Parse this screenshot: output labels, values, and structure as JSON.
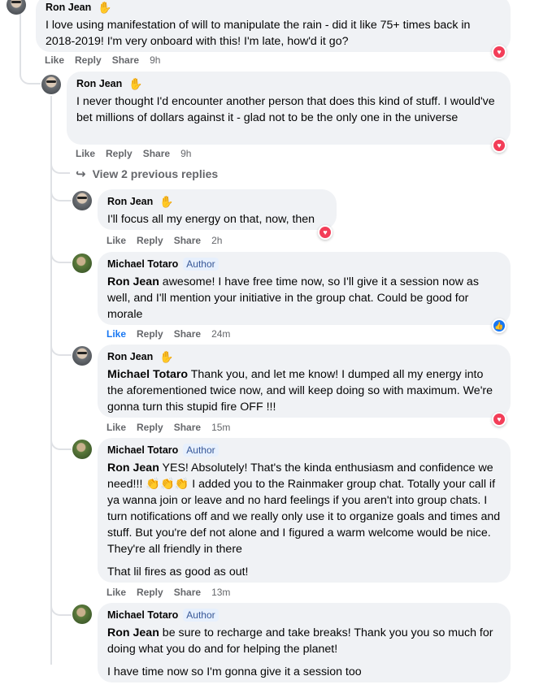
{
  "comments": [
    {
      "author": "Ron Jean",
      "text": "I love using manifestation of will to manipulate the rain - did it like 75+ times back in 2018-2019! I'm very onboard with this! I'm late, how'd it go?",
      "like": "Like",
      "reply": "Reply",
      "share": "Share",
      "time": "9h",
      "reaction": "love"
    },
    {
      "author": "Ron Jean",
      "text": "I never thought I'd encounter another person that does this kind of stuff. I would've bet millions of dollars against it - glad not to be the only one in the universe",
      "like": "Like",
      "reply": "Reply",
      "share": "Share",
      "time": "9h",
      "reaction": "love"
    },
    {
      "author": "Ron Jean",
      "text": "I'll focus all my energy on that, now, then",
      "like": "Like",
      "reply": "Reply",
      "share": "Share",
      "time": "2h",
      "reaction": "love"
    },
    {
      "author": "Michael Totaro",
      "badge": "Author",
      "mention": "Ron Jean",
      "text": " awesome! I have free time now, so I'll give it a session now as well, and I'll mention your initiative in the group chat. Could be good for morale",
      "like": "Like",
      "reply": "Reply",
      "share": "Share",
      "time": "24m",
      "reaction": "like"
    },
    {
      "author": "Ron Jean",
      "mention": "Michael Totaro",
      "text": " Thank you, and let me know! I dumped all my energy into the aforementioned twice now, and will keep doing so with maximum. We're gonna turn this stupid fire OFF !!!",
      "like": "Like",
      "reply": "Reply",
      "share": "Share",
      "time": "15m",
      "reaction": "love"
    },
    {
      "author": "Michael Totaro",
      "badge": "Author",
      "mention": "Ron Jean",
      "text": " YES! Absolutely! That's the kinda enthusiasm and confidence we need!!! 👏👏👏 I added you to the Rainmaker group chat. Totally your call if ya wanna join or leave and no hard feelings if you aren't into group chats. I turn notifications off and we really only use it to organize goals and times and stuff. But you're def not alone and I figured a warm welcome would be nice. They're all friendly in there",
      "text2": "That lil fires as good as out!",
      "like": "Like",
      "reply": "Reply",
      "share": "Share",
      "time": "13m"
    },
    {
      "author": "Michael Totaro",
      "badge": "Author",
      "mention": "Ron Jean",
      "text": " be sure to recharge and take breaks! Thank you you so much for doing what you do and for helping the planet!",
      "text2": "I have time now so I'm gonna give it a session too"
    }
  ],
  "view_replies": "View 2 previous replies",
  "icons": {
    "wave": "waving-hand-icon",
    "love": "heart-reaction-icon",
    "like": "thumbs-up-reaction-icon",
    "arrow": "reply-arrow-icon"
  },
  "colors": {
    "bubble": "#f0f2f5",
    "love": "#f33e58",
    "like": "#1877f2",
    "meta": "#65676b"
  }
}
